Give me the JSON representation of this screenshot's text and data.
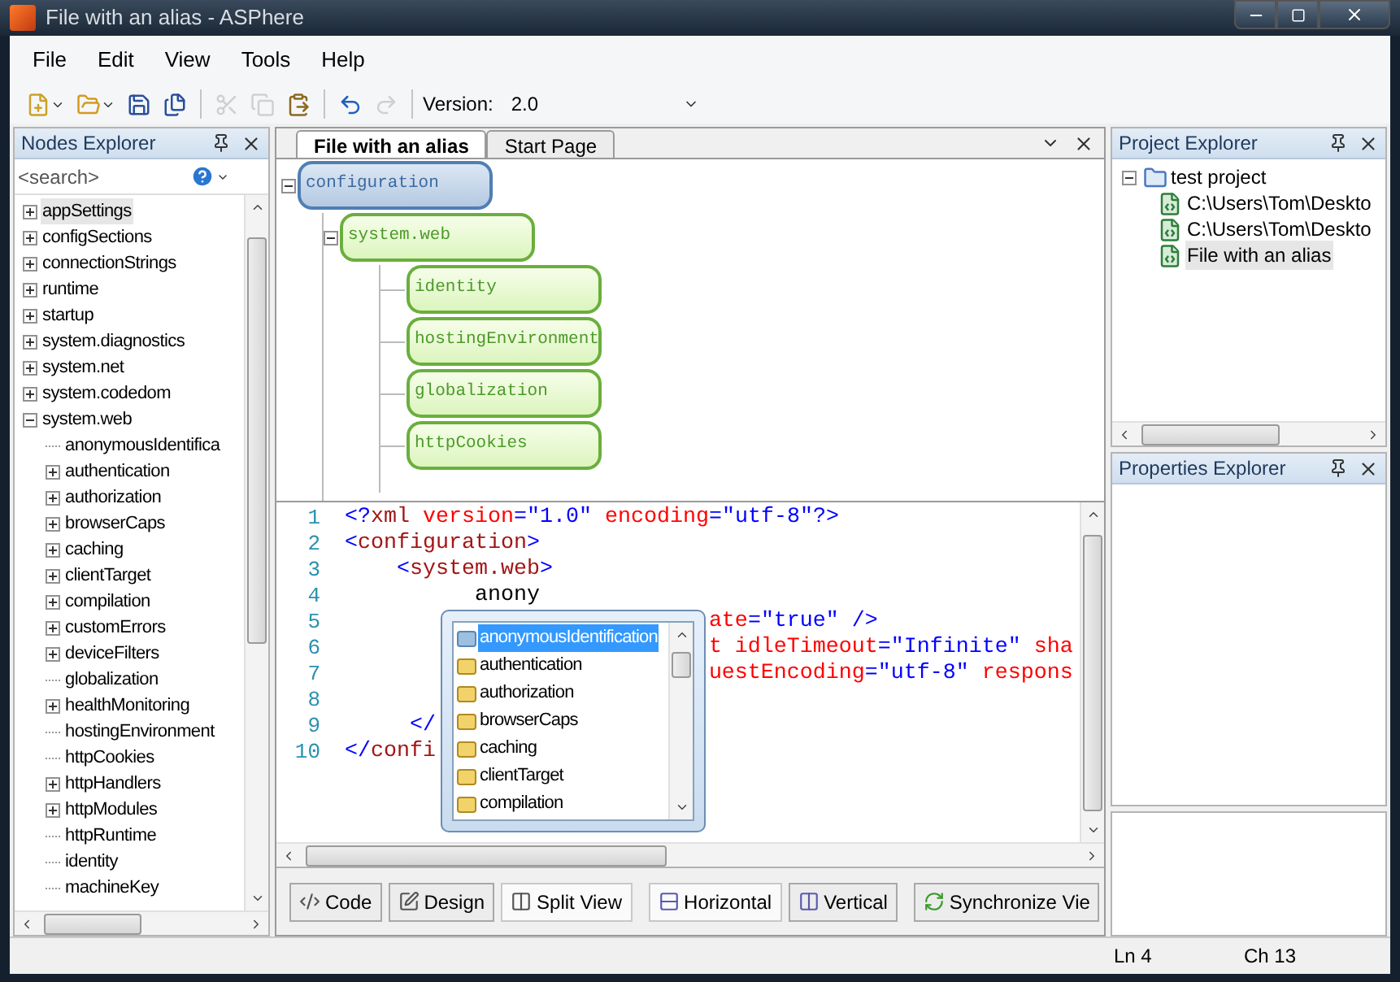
{
  "window": {
    "title": "File with an alias - ASPhere"
  },
  "menu": [
    "File",
    "Edit",
    "View",
    "Tools",
    "Help"
  ],
  "toolbar": {
    "groups": [
      [
        {
          "kind": "new",
          "disabled": false,
          "dropdown": true
        },
        {
          "kind": "open",
          "disabled": false,
          "dropdown": true
        },
        {
          "kind": "save",
          "disabled": false,
          "dropdown": false
        },
        {
          "kind": "save_all",
          "disabled": false,
          "dropdown": false
        }
      ],
      [
        {
          "kind": "cut",
          "disabled": true,
          "dropdown": false
        },
        {
          "kind": "copy",
          "disabled": true,
          "dropdown": false
        },
        {
          "kind": "paste",
          "disabled": false,
          "dropdown": false
        }
      ],
      [
        {
          "kind": "undo",
          "disabled": false,
          "dropdown": false
        },
        {
          "kind": "redo",
          "disabled": true,
          "dropdown": false
        }
      ]
    ],
    "version_label": "Version:",
    "version_value": "2.0"
  },
  "nodes_explorer": {
    "title": "Nodes Explorer",
    "search": {
      "placeholder": "<search>"
    },
    "items": [
      {
        "label": "appSettings",
        "kind": "folder",
        "expanded": false,
        "selected": true
      },
      {
        "label": "configSections",
        "kind": "folder",
        "expanded": false,
        "selected": false
      },
      {
        "label": "connectionStrings",
        "kind": "folder",
        "expanded": false,
        "selected": false
      },
      {
        "label": "runtime",
        "kind": "folder",
        "expanded": false,
        "selected": false
      },
      {
        "label": "startup",
        "kind": "folder",
        "expanded": false,
        "selected": false
      },
      {
        "label": "system.diagnostics",
        "kind": "folder",
        "expanded": false,
        "selected": false
      },
      {
        "label": "system.net",
        "kind": "folder",
        "expanded": false,
        "selected": false
      },
      {
        "label": "system.codedom",
        "kind": "folder",
        "expanded": false,
        "selected": false
      },
      {
        "label": "system.web",
        "kind": "folder",
        "expanded": true,
        "selected": false,
        "children": [
          {
            "label": "anonymousIdentifica",
            "kind": "leaf",
            "selected": false
          },
          {
            "label": "authentication",
            "kind": "folder",
            "expanded": false,
            "selected": false
          },
          {
            "label": "authorization",
            "kind": "folder",
            "expanded": false,
            "selected": false
          },
          {
            "label": "browserCaps",
            "kind": "folder",
            "expanded": false,
            "selected": false
          },
          {
            "label": "caching",
            "kind": "folder",
            "expanded": false,
            "selected": false
          },
          {
            "label": "clientTarget",
            "kind": "folder",
            "expanded": false,
            "selected": false
          },
          {
            "label": "compilation",
            "kind": "folder",
            "expanded": false,
            "selected": false
          },
          {
            "label": "customErrors",
            "kind": "folder",
            "expanded": false,
            "selected": false
          },
          {
            "label": "deviceFilters",
            "kind": "folder",
            "expanded": false,
            "selected": false
          },
          {
            "label": "globalization",
            "kind": "leaf",
            "selected": false
          },
          {
            "label": "healthMonitoring",
            "kind": "folder",
            "expanded": false,
            "selected": false
          },
          {
            "label": "hostingEnvironment",
            "kind": "leaf",
            "selected": false
          },
          {
            "label": "httpCookies",
            "kind": "leaf",
            "selected": false
          },
          {
            "label": "httpHandlers",
            "kind": "folder",
            "expanded": false,
            "selected": false
          },
          {
            "label": "httpModules",
            "kind": "folder",
            "expanded": false,
            "selected": false
          },
          {
            "label": "httpRuntime",
            "kind": "leaf",
            "selected": false
          },
          {
            "label": "identity",
            "kind": "leaf",
            "selected": false
          },
          {
            "label": "machineKey",
            "kind": "leaf",
            "selected": false
          }
        ]
      }
    ]
  },
  "editor": {
    "tabs": [
      {
        "label": "File with an alias",
        "selected": true
      },
      {
        "label": "Start Page",
        "selected": false
      }
    ],
    "diagram": {
      "label": "configuration",
      "kind": "root",
      "expanded": true,
      "children": [
        {
          "label": "system.web",
          "kind": "element",
          "expanded": true,
          "children": [
            {
              "label": "identity",
              "kind": "element"
            },
            {
              "label": "hostingEnvironment",
              "kind": "element"
            },
            {
              "label": "globalization",
              "kind": "element"
            },
            {
              "label": "httpCookies",
              "kind": "element"
            }
          ]
        }
      ]
    },
    "code_lines": [
      {
        "number": "1",
        "tokens": [
          {
            "kind": "punct",
            "text": "<?"
          },
          {
            "kind": "name",
            "text": "xml"
          },
          {
            "kind": "attr",
            "text": " version"
          },
          {
            "kind": "punct",
            "text": "="
          },
          {
            "kind": "value",
            "text": "\"1.0\""
          },
          {
            "kind": "attr",
            "text": " encoding"
          },
          {
            "kind": "punct",
            "text": "="
          },
          {
            "kind": "value",
            "text": "\"utf-8\""
          },
          {
            "kind": "punct",
            "text": "?>"
          }
        ]
      },
      {
        "number": "2",
        "tokens": [
          {
            "kind": "punct",
            "text": "<"
          },
          {
            "kind": "name",
            "text": "configuration"
          },
          {
            "kind": "punct",
            "text": ">"
          }
        ]
      },
      {
        "number": "3",
        "tokens": [
          {
            "kind": "punct",
            "text": "    <"
          },
          {
            "kind": "name",
            "text": "system.web"
          },
          {
            "kind": "punct",
            "text": ">"
          }
        ]
      },
      {
        "number": "4",
        "tokens": [
          {
            "kind": "text",
            "text": "          anony"
          }
        ]
      },
      {
        "number": "5",
        "tokens": [
          {
            "kind": "attr",
            "text": "                            ate"
          },
          {
            "kind": "punct",
            "text": "="
          },
          {
            "kind": "value",
            "text": "\"true\""
          },
          {
            "kind": "punct",
            "text": " />"
          }
        ]
      },
      {
        "number": "6",
        "tokens": [
          {
            "kind": "attr",
            "text": "                            t idleTimeout"
          },
          {
            "kind": "punct",
            "text": "="
          },
          {
            "kind": "value",
            "text": "\"Infinite\""
          },
          {
            "kind": "attr",
            "text": " sha"
          }
        ]
      },
      {
        "number": "7",
        "tokens": [
          {
            "kind": "attr",
            "text": "                            uestEncoding"
          },
          {
            "kind": "punct",
            "text": "="
          },
          {
            "kind": "value",
            "text": "\"utf-8\""
          },
          {
            "kind": "attr",
            "text": " respons"
          }
        ]
      },
      {
        "number": "8"
      },
      {
        "number": "9",
        "tokens": [
          {
            "kind": "punct",
            "text": "     </"
          }
        ]
      },
      {
        "number": "10",
        "tokens": [
          {
            "kind": "punct",
            "text": "</"
          },
          {
            "kind": "name",
            "text": "confi"
          }
        ]
      }
    ],
    "autocomplete": [
      {
        "label": "anonymousIdentification",
        "selected": true
      },
      {
        "label": "authentication",
        "selected": false
      },
      {
        "label": "authorization",
        "selected": false
      },
      {
        "label": "browserCaps",
        "selected": false
      },
      {
        "label": "caching",
        "selected": false
      },
      {
        "label": "clientTarget",
        "selected": false
      },
      {
        "label": "compilation",
        "selected": false
      }
    ],
    "view_groups": [
      [
        {
          "label": "Code",
          "kind": "code",
          "selected": false
        },
        {
          "label": "Design",
          "kind": "design",
          "selected": false
        },
        {
          "label": "Split View",
          "kind": "split",
          "selected": true
        }
      ],
      [
        {
          "label": "Horizontal",
          "kind": "horizontal",
          "selected": true
        },
        {
          "label": "Vertical",
          "kind": "vertical",
          "selected": false
        }
      ],
      [
        {
          "label": "Synchronize Vie",
          "kind": "sync",
          "selected": false
        }
      ]
    ]
  },
  "project_explorer": {
    "title": "Project Explorer",
    "root": {
      "label": "test project",
      "expanded": true,
      "children": [
        {
          "label": "C:\\Users\\Tom\\Deskto",
          "selected": false
        },
        {
          "label": "C:\\Users\\Tom\\Deskto",
          "selected": false
        },
        {
          "label": "File with an alias",
          "selected": true
        }
      ]
    }
  },
  "properties_explorer": {
    "title": "Properties Explorer"
  },
  "status_bar": {
    "line": "Ln 4",
    "column": "Ch 13"
  }
}
